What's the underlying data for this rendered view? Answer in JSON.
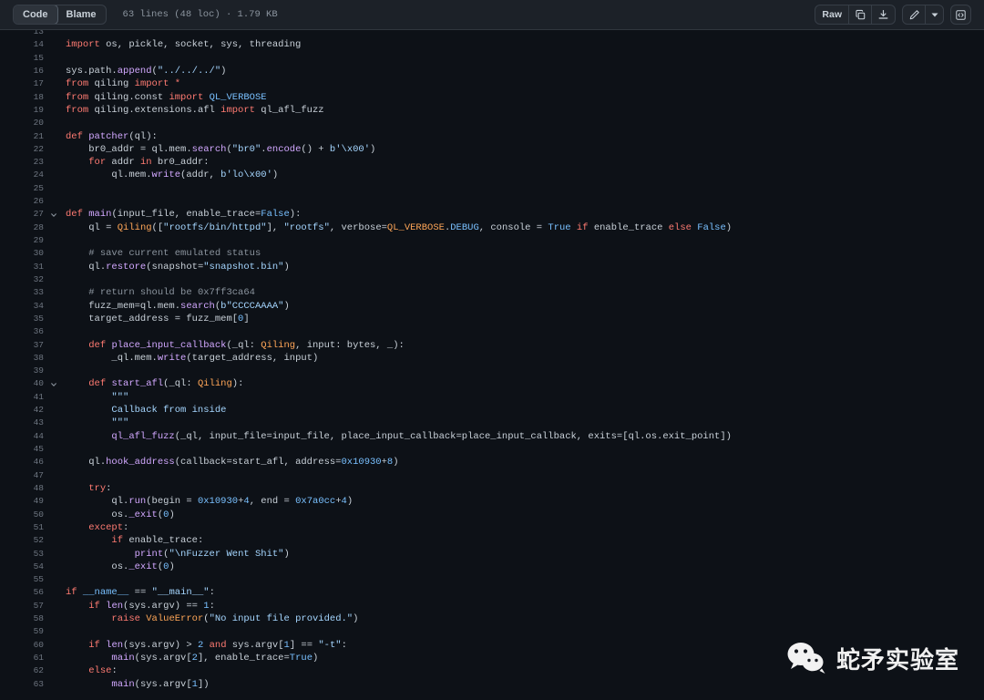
{
  "toolbar": {
    "tabs": [
      {
        "label": "Code",
        "active": true
      },
      {
        "label": "Blame",
        "active": false
      }
    ],
    "file_meta": "63 lines (48 loc) · 1.79 KB",
    "raw_label": "Raw",
    "icons": {
      "copy": "copy-icon",
      "download": "download-icon",
      "edit": "pencil-icon",
      "dropdown": "chevron-down-icon",
      "symbols": "code-symbols-icon"
    }
  },
  "colors": {
    "header_bg": "#1c2128",
    "code_bg": "#0d1117",
    "border": "#30363d",
    "text": "#c9d1d9",
    "line_number": "#6e7681",
    "keyword": "#ff7b72",
    "string": "#a5d6ff",
    "comment": "#8b949e",
    "function": "#d2a8ff",
    "number": "#79c0ff",
    "type": "#ffa657"
  },
  "watermark": {
    "text": "蛇矛实验室",
    "logo": "wechat-logo"
  },
  "code": {
    "language": "python",
    "first_visible_line": 13,
    "lines": [
      {
        "n": 13,
        "fold": false,
        "partial": true,
        "tokens": []
      },
      {
        "n": 14,
        "fold": false,
        "tokens": [
          {
            "t": "import",
            "c": "k"
          },
          {
            "t": " os, pickle, socket, sys, threading",
            "c": "p"
          }
        ]
      },
      {
        "n": 15,
        "fold": false,
        "tokens": []
      },
      {
        "n": 16,
        "fold": false,
        "tokens": [
          {
            "t": "sys.path.",
            "c": "p"
          },
          {
            "t": "append",
            "c": "f"
          },
          {
            "t": "(",
            "c": "p"
          },
          {
            "t": "\"../../../\"",
            "c": "s"
          },
          {
            "t": ")",
            "c": "p"
          }
        ]
      },
      {
        "n": 17,
        "fold": false,
        "tokens": [
          {
            "t": "from",
            "c": "k"
          },
          {
            "t": " qiling ",
            "c": "p"
          },
          {
            "t": "import",
            "c": "k"
          },
          {
            "t": " ",
            "c": "p"
          },
          {
            "t": "*",
            "c": "k"
          }
        ]
      },
      {
        "n": 18,
        "fold": false,
        "tokens": [
          {
            "t": "from",
            "c": "k"
          },
          {
            "t": " qiling.const ",
            "c": "p"
          },
          {
            "t": "import",
            "c": "k"
          },
          {
            "t": " ",
            "c": "p"
          },
          {
            "t": "QL_VERBOSE",
            "c": "n"
          }
        ]
      },
      {
        "n": 19,
        "fold": false,
        "tokens": [
          {
            "t": "from",
            "c": "k"
          },
          {
            "t": " qiling.extensions.afl ",
            "c": "p"
          },
          {
            "t": "import",
            "c": "k"
          },
          {
            "t": " ql_afl_fuzz",
            "c": "p"
          }
        ]
      },
      {
        "n": 20,
        "fold": false,
        "tokens": []
      },
      {
        "n": 21,
        "fold": false,
        "tokens": [
          {
            "t": "def",
            "c": "k"
          },
          {
            "t": " ",
            "c": "p"
          },
          {
            "t": "patcher",
            "c": "f"
          },
          {
            "t": "(ql):",
            "c": "p"
          }
        ]
      },
      {
        "n": 22,
        "fold": false,
        "indent": 4,
        "tokens": [
          {
            "t": "br0_addr = ql.mem.",
            "c": "p"
          },
          {
            "t": "search",
            "c": "f"
          },
          {
            "t": "(",
            "c": "p"
          },
          {
            "t": "\"br0\"",
            "c": "s"
          },
          {
            "t": ".",
            "c": "p"
          },
          {
            "t": "encode",
            "c": "f"
          },
          {
            "t": "() + ",
            "c": "p"
          },
          {
            "t": "b'\\x00'",
            "c": "s"
          },
          {
            "t": ")",
            "c": "p"
          }
        ]
      },
      {
        "n": 23,
        "fold": false,
        "indent": 4,
        "tokens": [
          {
            "t": "for",
            "c": "k"
          },
          {
            "t": " addr ",
            "c": "p"
          },
          {
            "t": "in",
            "c": "k"
          },
          {
            "t": " br0_addr:",
            "c": "p"
          }
        ]
      },
      {
        "n": 24,
        "fold": false,
        "indent": 8,
        "tokens": [
          {
            "t": "ql.mem.",
            "c": "p"
          },
          {
            "t": "write",
            "c": "f"
          },
          {
            "t": "(addr, ",
            "c": "p"
          },
          {
            "t": "b'lo\\x00'",
            "c": "s"
          },
          {
            "t": ")",
            "c": "p"
          }
        ]
      },
      {
        "n": 25,
        "fold": false,
        "tokens": []
      },
      {
        "n": 26,
        "fold": false,
        "tokens": []
      },
      {
        "n": 27,
        "fold": true,
        "tokens": [
          {
            "t": "def",
            "c": "k"
          },
          {
            "t": " ",
            "c": "p"
          },
          {
            "t": "main",
            "c": "f"
          },
          {
            "t": "(input_file, enable_trace=",
            "c": "p"
          },
          {
            "t": "False",
            "c": "n"
          },
          {
            "t": "):",
            "c": "p"
          }
        ]
      },
      {
        "n": 28,
        "fold": false,
        "indent": 4,
        "tokens": [
          {
            "t": "ql = ",
            "c": "p"
          },
          {
            "t": "Qiling",
            "c": "t"
          },
          {
            "t": "([",
            "c": "p"
          },
          {
            "t": "\"rootfs/bin/httpd\"",
            "c": "s"
          },
          {
            "t": "], ",
            "c": "p"
          },
          {
            "t": "\"rootfs\"",
            "c": "s"
          },
          {
            "t": ", verbose=",
            "c": "p"
          },
          {
            "t": "QL_VERBOSE",
            "c": "t"
          },
          {
            "t": ".",
            "c": "p"
          },
          {
            "t": "DEBUG",
            "c": "n"
          },
          {
            "t": ", console = ",
            "c": "p"
          },
          {
            "t": "True",
            "c": "n"
          },
          {
            "t": " ",
            "c": "p"
          },
          {
            "t": "if",
            "c": "k"
          },
          {
            "t": " enable_trace ",
            "c": "p"
          },
          {
            "t": "else",
            "c": "k"
          },
          {
            "t": " ",
            "c": "p"
          },
          {
            "t": "False",
            "c": "n"
          },
          {
            "t": ")",
            "c": "p"
          }
        ]
      },
      {
        "n": 29,
        "fold": false,
        "tokens": []
      },
      {
        "n": 30,
        "fold": false,
        "indent": 4,
        "tokens": [
          {
            "t": "# save current emulated status",
            "c": "c"
          }
        ]
      },
      {
        "n": 31,
        "fold": false,
        "indent": 4,
        "tokens": [
          {
            "t": "ql.",
            "c": "p"
          },
          {
            "t": "restore",
            "c": "f"
          },
          {
            "t": "(snapshot=",
            "c": "p"
          },
          {
            "t": "\"snapshot.bin\"",
            "c": "s"
          },
          {
            "t": ")",
            "c": "p"
          }
        ]
      },
      {
        "n": 32,
        "fold": false,
        "tokens": []
      },
      {
        "n": 33,
        "fold": false,
        "indent": 4,
        "tokens": [
          {
            "t": "# return should be 0x7ff3ca64",
            "c": "c"
          }
        ]
      },
      {
        "n": 34,
        "fold": false,
        "indent": 4,
        "tokens": [
          {
            "t": "fuzz_mem=ql.mem.",
            "c": "p"
          },
          {
            "t": "search",
            "c": "f"
          },
          {
            "t": "(",
            "c": "p"
          },
          {
            "t": "b\"CCCCAAAA\"",
            "c": "s"
          },
          {
            "t": ")",
            "c": "p"
          }
        ]
      },
      {
        "n": 35,
        "fold": false,
        "indent": 4,
        "tokens": [
          {
            "t": "target_address = fuzz_mem[",
            "c": "p"
          },
          {
            "t": "0",
            "c": "n"
          },
          {
            "t": "]",
            "c": "p"
          }
        ]
      },
      {
        "n": 36,
        "fold": false,
        "tokens": []
      },
      {
        "n": 37,
        "fold": false,
        "indent": 4,
        "tokens": [
          {
            "t": "def",
            "c": "k"
          },
          {
            "t": " ",
            "c": "p"
          },
          {
            "t": "place_input_callback",
            "c": "f"
          },
          {
            "t": "(_ql: ",
            "c": "p"
          },
          {
            "t": "Qiling",
            "c": "t"
          },
          {
            "t": ", input: bytes, _):",
            "c": "p"
          }
        ]
      },
      {
        "n": 38,
        "fold": false,
        "indent": 8,
        "tokens": [
          {
            "t": "_ql.mem.",
            "c": "p"
          },
          {
            "t": "write",
            "c": "f"
          },
          {
            "t": "(target_address, input)",
            "c": "p"
          }
        ]
      },
      {
        "n": 39,
        "fold": false,
        "tokens": []
      },
      {
        "n": 40,
        "fold": true,
        "indent": 4,
        "tokens": [
          {
            "t": "def",
            "c": "k"
          },
          {
            "t": " ",
            "c": "p"
          },
          {
            "t": "start_afl",
            "c": "f"
          },
          {
            "t": "(_ql: ",
            "c": "p"
          },
          {
            "t": "Qiling",
            "c": "t"
          },
          {
            "t": "):",
            "c": "p"
          }
        ]
      },
      {
        "n": 41,
        "fold": false,
        "indent": 8,
        "tokens": [
          {
            "t": "\"\"\"",
            "c": "s"
          }
        ]
      },
      {
        "n": 42,
        "fold": false,
        "indent": 8,
        "tokens": [
          {
            "t": "Callback from inside",
            "c": "s"
          }
        ]
      },
      {
        "n": 43,
        "fold": false,
        "indent": 8,
        "tokens": [
          {
            "t": "\"\"\"",
            "c": "s"
          }
        ]
      },
      {
        "n": 44,
        "fold": false,
        "indent": 8,
        "tokens": [
          {
            "t": "ql_afl_fuzz",
            "c": "f"
          },
          {
            "t": "(_ql, input_file=input_file, place_input_callback=place_input_callback, exits=[ql.os.exit_point])",
            "c": "p"
          }
        ]
      },
      {
        "n": 45,
        "fold": false,
        "tokens": []
      },
      {
        "n": 46,
        "fold": false,
        "indent": 4,
        "tokens": [
          {
            "t": "ql.",
            "c": "p"
          },
          {
            "t": "hook_address",
            "c": "f"
          },
          {
            "t": "(callback=start_afl, address=",
            "c": "p"
          },
          {
            "t": "0x10930",
            "c": "n"
          },
          {
            "t": "+",
            "c": "p"
          },
          {
            "t": "8",
            "c": "n"
          },
          {
            "t": ")",
            "c": "p"
          }
        ]
      },
      {
        "n": 47,
        "fold": false,
        "tokens": []
      },
      {
        "n": 48,
        "fold": false,
        "indent": 4,
        "tokens": [
          {
            "t": "try",
            "c": "k"
          },
          {
            "t": ":",
            "c": "p"
          }
        ]
      },
      {
        "n": 49,
        "fold": false,
        "indent": 8,
        "tokens": [
          {
            "t": "ql.",
            "c": "p"
          },
          {
            "t": "run",
            "c": "f"
          },
          {
            "t": "(begin = ",
            "c": "p"
          },
          {
            "t": "0x10930",
            "c": "n"
          },
          {
            "t": "+",
            "c": "p"
          },
          {
            "t": "4",
            "c": "n"
          },
          {
            "t": ", end = ",
            "c": "p"
          },
          {
            "t": "0x7a0cc",
            "c": "n"
          },
          {
            "t": "+",
            "c": "p"
          },
          {
            "t": "4",
            "c": "n"
          },
          {
            "t": ")",
            "c": "p"
          }
        ]
      },
      {
        "n": 50,
        "fold": false,
        "indent": 8,
        "tokens": [
          {
            "t": "os.",
            "c": "p"
          },
          {
            "t": "_exit",
            "c": "f"
          },
          {
            "t": "(",
            "c": "p"
          },
          {
            "t": "0",
            "c": "n"
          },
          {
            "t": ")",
            "c": "p"
          }
        ]
      },
      {
        "n": 51,
        "fold": false,
        "indent": 4,
        "tokens": [
          {
            "t": "except",
            "c": "k"
          },
          {
            "t": ":",
            "c": "p"
          }
        ]
      },
      {
        "n": 52,
        "fold": false,
        "indent": 8,
        "tokens": [
          {
            "t": "if",
            "c": "k"
          },
          {
            "t": " enable_trace:",
            "c": "p"
          }
        ]
      },
      {
        "n": 53,
        "fold": false,
        "indent": 12,
        "tokens": [
          {
            "t": "print",
            "c": "f"
          },
          {
            "t": "(",
            "c": "p"
          },
          {
            "t": "\"\\nFuzzer Went Shit\"",
            "c": "s"
          },
          {
            "t": ")",
            "c": "p"
          }
        ]
      },
      {
        "n": 54,
        "fold": false,
        "indent": 8,
        "tokens": [
          {
            "t": "os.",
            "c": "p"
          },
          {
            "t": "_exit",
            "c": "f"
          },
          {
            "t": "(",
            "c": "p"
          },
          {
            "t": "0",
            "c": "n"
          },
          {
            "t": ")",
            "c": "p"
          }
        ]
      },
      {
        "n": 55,
        "fold": false,
        "tokens": []
      },
      {
        "n": 56,
        "fold": false,
        "tokens": [
          {
            "t": "if",
            "c": "k"
          },
          {
            "t": " ",
            "c": "p"
          },
          {
            "t": "__name__",
            "c": "n"
          },
          {
            "t": " == ",
            "c": "p"
          },
          {
            "t": "\"__main__\"",
            "c": "s"
          },
          {
            "t": ":",
            "c": "p"
          }
        ]
      },
      {
        "n": 57,
        "fold": false,
        "indent": 4,
        "tokens": [
          {
            "t": "if",
            "c": "k"
          },
          {
            "t": " ",
            "c": "p"
          },
          {
            "t": "len",
            "c": "f"
          },
          {
            "t": "(sys.argv) == ",
            "c": "p"
          },
          {
            "t": "1",
            "c": "n"
          },
          {
            "t": ":",
            "c": "p"
          }
        ]
      },
      {
        "n": 58,
        "fold": false,
        "indent": 8,
        "tokens": [
          {
            "t": "raise",
            "c": "k"
          },
          {
            "t": " ",
            "c": "p"
          },
          {
            "t": "ValueError",
            "c": "t"
          },
          {
            "t": "(",
            "c": "p"
          },
          {
            "t": "\"No input file provided.\"",
            "c": "s"
          },
          {
            "t": ")",
            "c": "p"
          }
        ]
      },
      {
        "n": 59,
        "fold": false,
        "tokens": []
      },
      {
        "n": 60,
        "fold": false,
        "indent": 4,
        "tokens": [
          {
            "t": "if",
            "c": "k"
          },
          {
            "t": " ",
            "c": "p"
          },
          {
            "t": "len",
            "c": "f"
          },
          {
            "t": "(sys.argv) > ",
            "c": "p"
          },
          {
            "t": "2",
            "c": "n"
          },
          {
            "t": " ",
            "c": "p"
          },
          {
            "t": "and",
            "c": "k"
          },
          {
            "t": " sys.argv[",
            "c": "p"
          },
          {
            "t": "1",
            "c": "n"
          },
          {
            "t": "] == ",
            "c": "p"
          },
          {
            "t": "\"-t\"",
            "c": "s"
          },
          {
            "t": ":",
            "c": "p"
          }
        ]
      },
      {
        "n": 61,
        "fold": false,
        "indent": 8,
        "tokens": [
          {
            "t": "main",
            "c": "f"
          },
          {
            "t": "(sys.argv[",
            "c": "p"
          },
          {
            "t": "2",
            "c": "n"
          },
          {
            "t": "], enable_trace=",
            "c": "p"
          },
          {
            "t": "True",
            "c": "n"
          },
          {
            "t": ")",
            "c": "p"
          }
        ]
      },
      {
        "n": 62,
        "fold": false,
        "indent": 4,
        "tokens": [
          {
            "t": "else",
            "c": "k"
          },
          {
            "t": ":",
            "c": "p"
          }
        ]
      },
      {
        "n": 63,
        "fold": false,
        "indent": 8,
        "tokens": [
          {
            "t": "main",
            "c": "f"
          },
          {
            "t": "(sys.argv[",
            "c": "p"
          },
          {
            "t": "1",
            "c": "n"
          },
          {
            "t": "])",
            "c": "p"
          }
        ]
      }
    ]
  }
}
